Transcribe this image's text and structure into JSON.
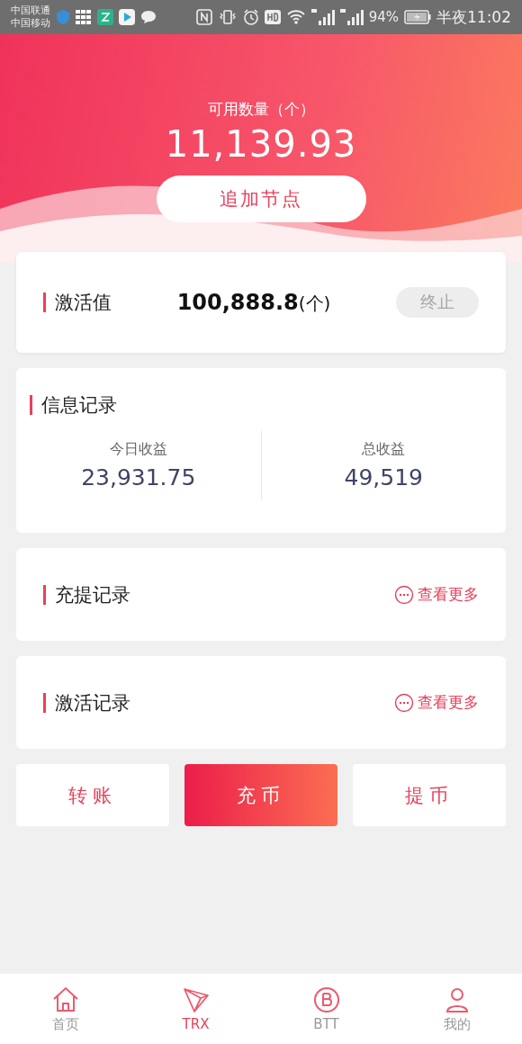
{
  "status_bar": {
    "carriers": [
      "中国联通",
      "中国移动"
    ],
    "battery": "94%",
    "time": "半夜11:02"
  },
  "header": {
    "label": "可用数量（个）",
    "amount": "11,139.93",
    "button": "追加节点"
  },
  "activation": {
    "title": "激活值",
    "value": "100,888.8",
    "unit": "(个)",
    "button": {
      "label": "终止",
      "disabled": true
    }
  },
  "info": {
    "title": "信息记录",
    "stats": [
      {
        "label": "今日收益",
        "value": "23,931.75"
      },
      {
        "label": "总收益",
        "value": "49,519"
      }
    ]
  },
  "records": [
    {
      "title": "充提记录",
      "more": "查看更多"
    },
    {
      "title": "激活记录",
      "more": "查看更多"
    }
  ],
  "actions": [
    {
      "label": "转账",
      "primary": false
    },
    {
      "label": "充币",
      "primary": true
    },
    {
      "label": "提币",
      "primary": false
    }
  ],
  "tabs": [
    {
      "label": "首页",
      "kind": "home",
      "selected": false
    },
    {
      "label": "TRX",
      "kind": "trx",
      "selected": true
    },
    {
      "label": "BTT",
      "kind": "btt",
      "selected": false
    },
    {
      "label": "我的",
      "kind": "user",
      "selected": false
    }
  ]
}
